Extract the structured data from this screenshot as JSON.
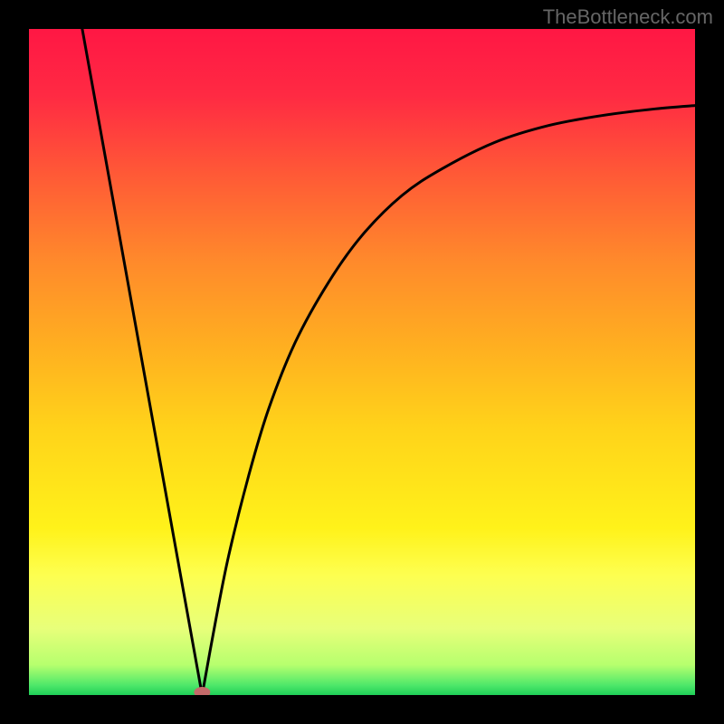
{
  "watermark": "TheBottleneck.com",
  "chart_data": {
    "type": "line",
    "title": "",
    "xlabel": "",
    "ylabel": "",
    "xlim": [
      0,
      100
    ],
    "ylim": [
      0,
      100
    ],
    "notch": {
      "x": 26,
      "y": 0
    },
    "left_line": {
      "x0": 8,
      "y0": 100,
      "x1": 26,
      "y1": 0
    },
    "right_curve_points": [
      {
        "x": 26,
        "y": 0
      },
      {
        "x": 28,
        "y": 11
      },
      {
        "x": 30,
        "y": 21
      },
      {
        "x": 33,
        "y": 33
      },
      {
        "x": 36,
        "y": 43
      },
      {
        "x": 40,
        "y": 53
      },
      {
        "x": 45,
        "y": 62
      },
      {
        "x": 50,
        "y": 69
      },
      {
        "x": 56,
        "y": 75
      },
      {
        "x": 62,
        "y": 79
      },
      {
        "x": 70,
        "y": 83
      },
      {
        "x": 78,
        "y": 85.5
      },
      {
        "x": 86,
        "y": 87
      },
      {
        "x": 94,
        "y": 88
      },
      {
        "x": 100,
        "y": 88.5
      }
    ],
    "marker": {
      "x": 26,
      "y": 0,
      "color": "#c46a6a"
    },
    "gradient_stops": [
      {
        "offset": 0,
        "color": "#ff1744"
      },
      {
        "offset": 0.1,
        "color": "#ff2a43"
      },
      {
        "offset": 0.22,
        "color": "#ff5a36"
      },
      {
        "offset": 0.35,
        "color": "#ff8a2b"
      },
      {
        "offset": 0.48,
        "color": "#ffb020"
      },
      {
        "offset": 0.6,
        "color": "#ffd31a"
      },
      {
        "offset": 0.75,
        "color": "#fff21a"
      },
      {
        "offset": 0.82,
        "color": "#fdff50"
      },
      {
        "offset": 0.9,
        "color": "#e8ff7a"
      },
      {
        "offset": 0.955,
        "color": "#b6ff6e"
      },
      {
        "offset": 0.985,
        "color": "#4fe86a"
      },
      {
        "offset": 1.0,
        "color": "#1fcf58"
      }
    ]
  }
}
